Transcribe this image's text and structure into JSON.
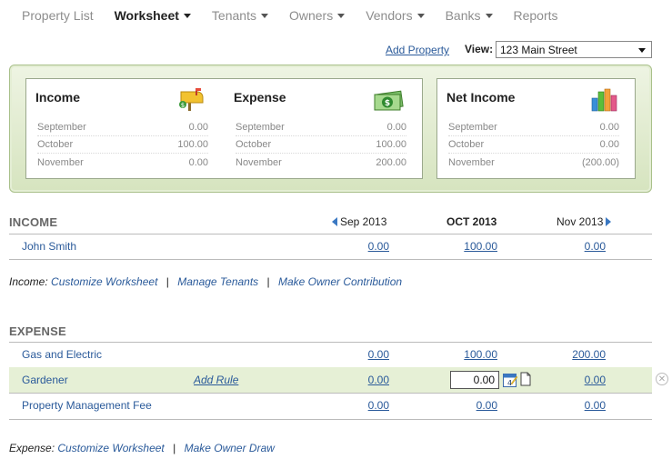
{
  "nav": {
    "items": [
      {
        "label": "Property List",
        "dropdown": false,
        "active": false
      },
      {
        "label": "Worksheet",
        "dropdown": true,
        "active": true
      },
      {
        "label": "Tenants",
        "dropdown": true,
        "active": false
      },
      {
        "label": "Owners",
        "dropdown": true,
        "active": false
      },
      {
        "label": "Vendors",
        "dropdown": true,
        "active": false
      },
      {
        "label": "Banks",
        "dropdown": true,
        "active": false
      },
      {
        "label": "Reports",
        "dropdown": false,
        "active": false
      }
    ]
  },
  "viewbar": {
    "add_property": "Add Property",
    "view_label": "View:",
    "view_value": "123 Main Street"
  },
  "summary": {
    "income": {
      "title": "Income",
      "rows": [
        {
          "month": "September",
          "value": "0.00"
        },
        {
          "month": "October",
          "value": "100.00"
        },
        {
          "month": "November",
          "value": "0.00"
        }
      ]
    },
    "expense": {
      "title": "Expense",
      "rows": [
        {
          "month": "September",
          "value": "0.00"
        },
        {
          "month": "October",
          "value": "100.00"
        },
        {
          "month": "November",
          "value": "200.00"
        }
      ]
    },
    "net": {
      "title": "Net Income",
      "rows": [
        {
          "month": "September",
          "value": "0.00"
        },
        {
          "month": "October",
          "value": "0.00"
        },
        {
          "month": "November",
          "value": "(200.00)"
        }
      ]
    }
  },
  "income_section": {
    "title": "INCOME",
    "columns": {
      "prev": "Sep 2013",
      "current": "OCT 2013",
      "next": "Nov 2013"
    },
    "rows": [
      {
        "name": "John Smith",
        "sep": "0.00",
        "oct": "100.00",
        "nov": "0.00"
      }
    ],
    "footer": {
      "label": "Income:",
      "links": [
        "Customize Worksheet",
        "Manage Tenants",
        "Make Owner Contribution"
      ]
    }
  },
  "expense_section": {
    "title": "EXPENSE",
    "rows": [
      {
        "name": "Gas and Electric",
        "sep": "0.00",
        "oct": "100.00",
        "nov": "200.00"
      },
      {
        "name": "Gardener",
        "rule": "Add Rule",
        "sep": "0.00",
        "oct_input": "0.00",
        "nov": "0.00"
      },
      {
        "name": "Property Management Fee",
        "sep": "0.00",
        "oct": "0.00",
        "nov": "0.00"
      }
    ],
    "footer": {
      "label": "Expense:",
      "links": [
        "Customize Worksheet",
        "Make Owner Draw"
      ]
    }
  },
  "icons": {
    "mailbox": "mailbox-icon",
    "money": "money-icon",
    "chart": "bar-chart-icon",
    "calendar": "calendar-icon",
    "note": "note-icon",
    "remove": "remove-icon"
  },
  "colors": {
    "link": "#2a5a9a",
    "panel_bg": "#d6e4bf",
    "highlight_row": "#e6f0d6"
  }
}
